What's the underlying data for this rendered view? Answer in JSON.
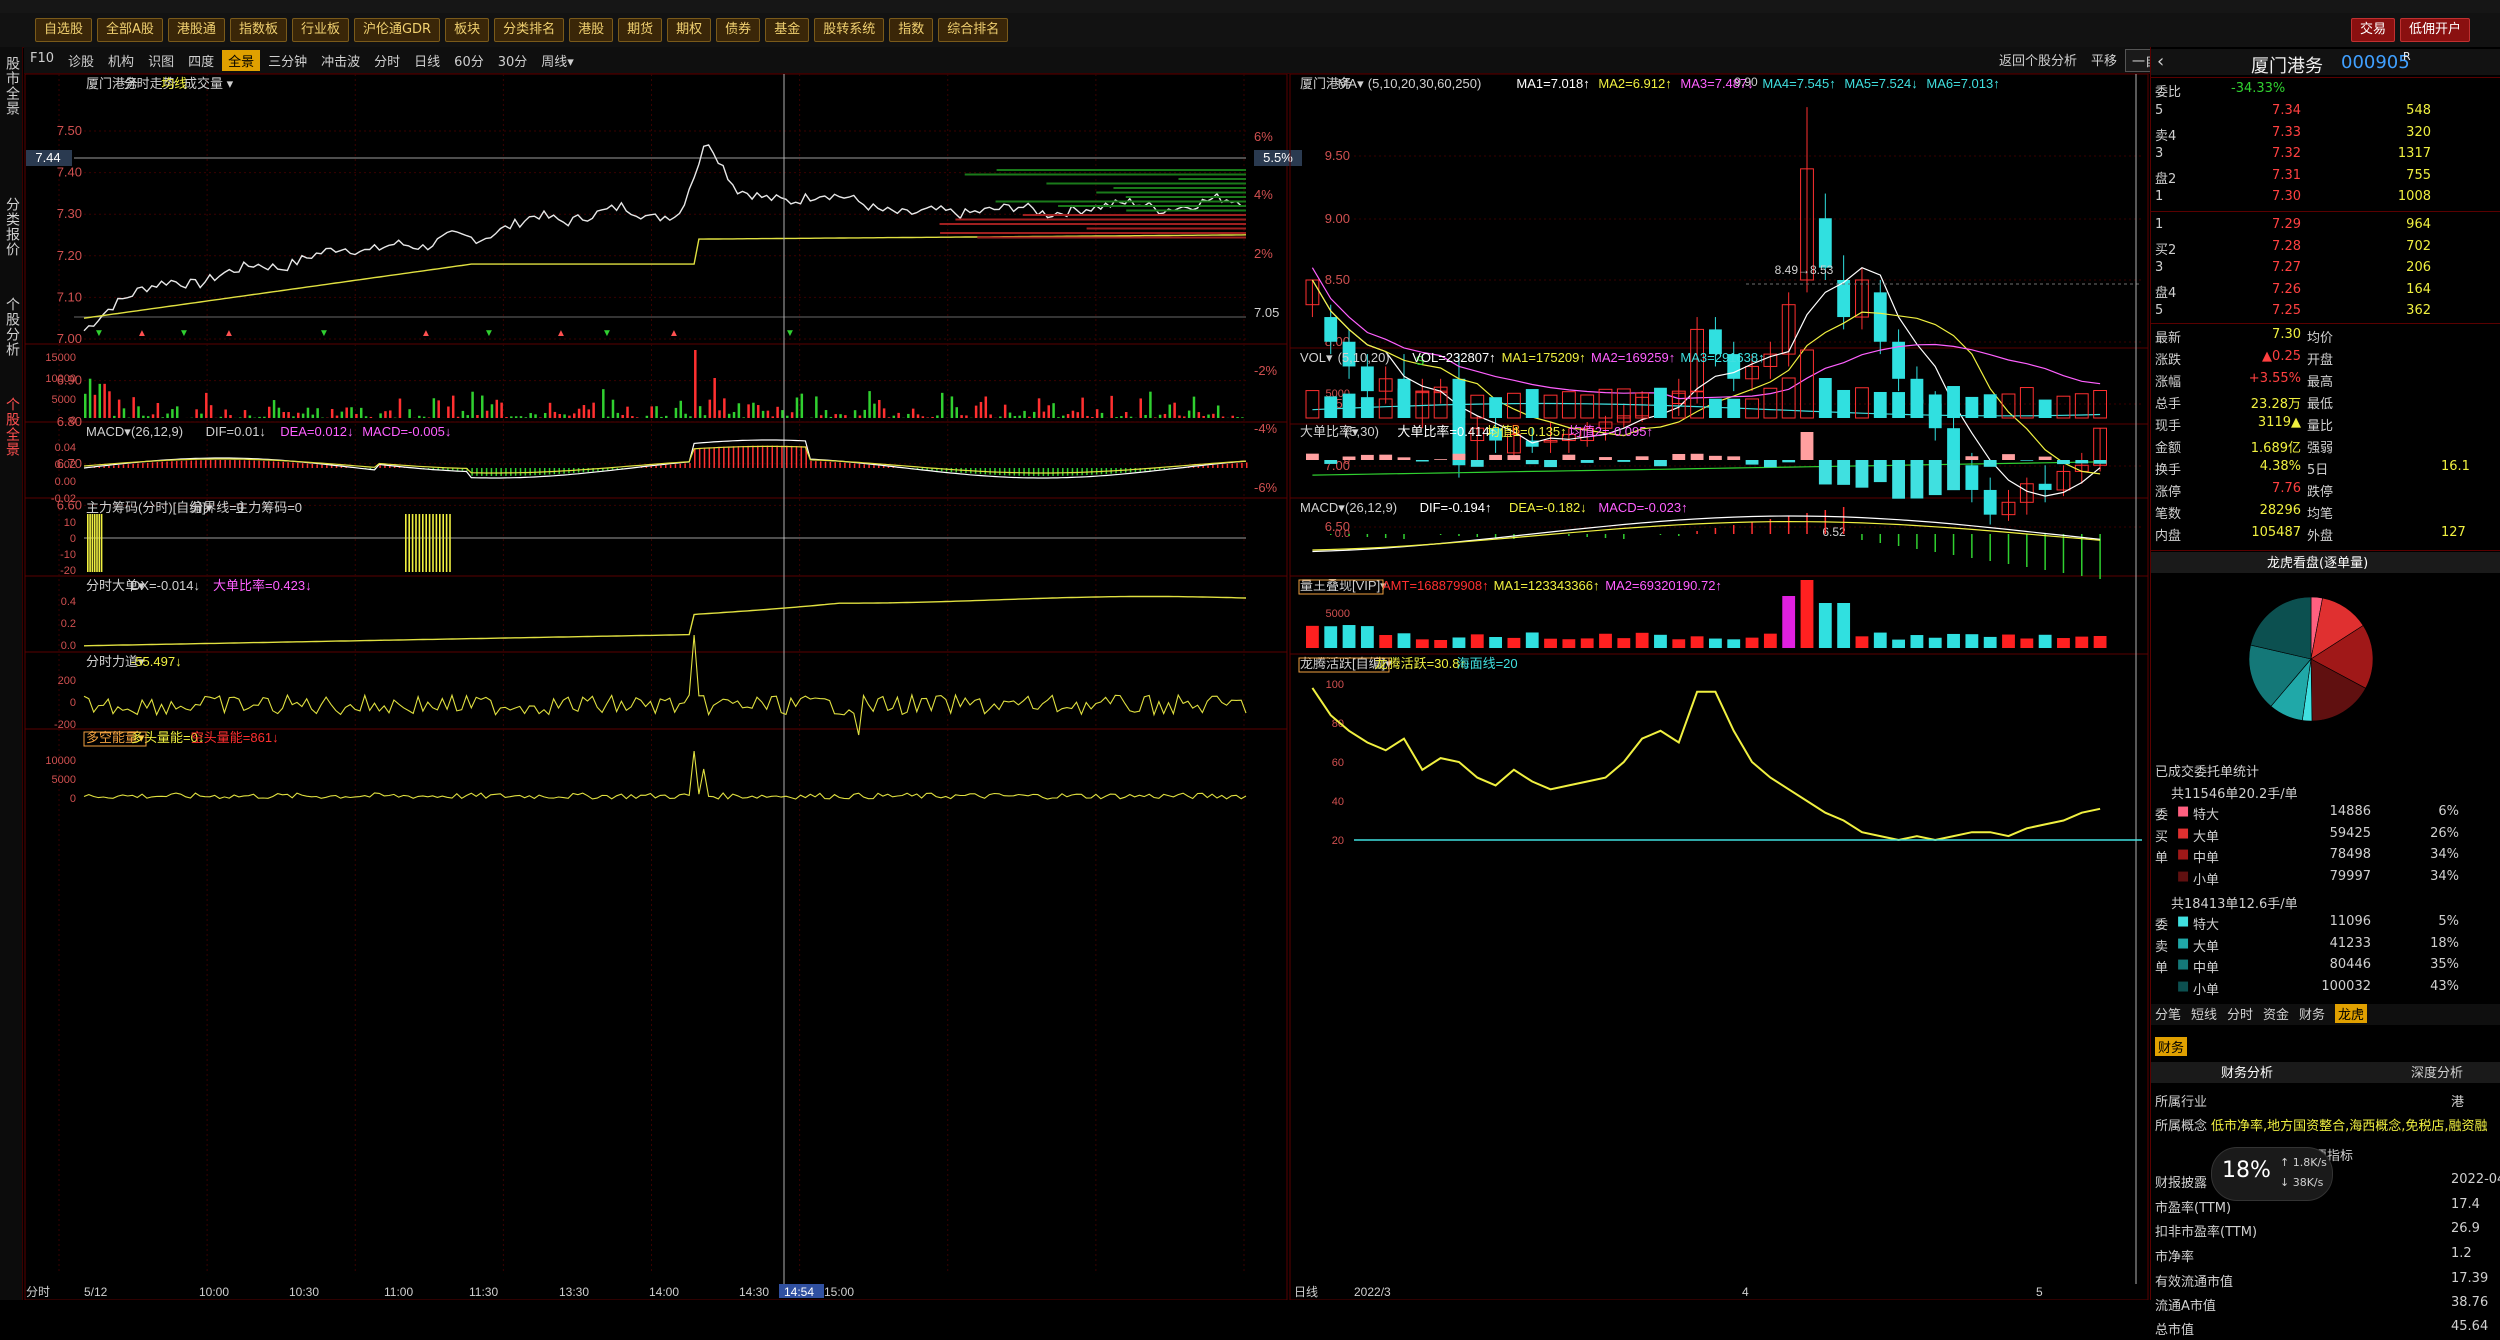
{
  "toolbar": {
    "buttons": [
      "自选股",
      "全部A股",
      "港股通",
      "指数板",
      "行业板",
      "沪伦通GDR",
      "板块",
      "分类排名",
      "港股",
      "期货",
      "期权",
      "债券",
      "基金",
      "股转系统",
      "指数",
      "综合排名"
    ],
    "right_buttons": [
      "交易",
      "低佣开户"
    ]
  },
  "left_tabs": [
    "股市全景",
    "分类报价",
    "个股分析",
    "个股全景"
  ],
  "subbar": {
    "left": [
      "F10",
      "诊股",
      "机构",
      "识图",
      "四度",
      "全景",
      "三分钟",
      "冲击波",
      "分时",
      "日线",
      "60分",
      "30分",
      "周线▾"
    ],
    "right": [
      "返回个股分析",
      "平移",
      "一自选"
    ]
  },
  "intraday": {
    "title": [
      "厦门港务",
      "分时走势",
      "均线",
      "成交量 ▾"
    ],
    "price_ticks": [
      "7.50",
      "7.40",
      "7.30",
      "7.20",
      "7.10",
      "7.00",
      "6.90",
      "6.80",
      "6.70",
      "6.60"
    ],
    "pct_ticks": [
      "6%",
      "4%",
      "2%",
      "7.05",
      "-2%",
      "-4%",
      "-6%"
    ],
    "current_price": "7.44",
    "current_pct": "5.5%",
    "vol_ticks": [
      "15000",
      "10000",
      "5000",
      "0"
    ],
    "macd_title": [
      "MACD▾",
      "(26,12,9)",
      "DIF=0.01↓",
      "DEA=0.012↓",
      "MACD=-0.005↓"
    ],
    "macd_ticks": [
      "0.04",
      "0.02",
      "0.00",
      "-0.02"
    ],
    "main_title": [
      "主力筹码(分时)[自编]▾",
      "分界线=0",
      "主力筹码=0"
    ],
    "main_ticks": [
      "10",
      "0",
      "-10",
      "-20"
    ],
    "big_title": [
      "分时大单▾",
      "DX=-0.014↓",
      "大单比率=0.423↓"
    ],
    "big_ticks": [
      "0.4",
      "0.2",
      "0.0"
    ],
    "force_title": [
      "分时力道▾",
      "-55.497↓"
    ],
    "force_ticks": [
      "200",
      "0",
      "-200"
    ],
    "energy_title": [
      "多空能量▾",
      "多头量能=0↓",
      "空头量能=861↓"
    ],
    "energy_ticks": [
      "10000",
      "5000",
      "0"
    ],
    "x_labels": [
      "分时",
      "5/12",
      "10:00",
      "10:30",
      "11:00",
      "11:30",
      "13:30",
      "14:00",
      "14:30",
      "14:54",
      "15:00"
    ]
  },
  "kline": {
    "title": [
      "厦门港务",
      "MA▾",
      "(5,10,20,30,60,250)",
      "MA1=7.018↑",
      "MA2=6.912↑",
      "MA3=7.487↓",
      "MA4=7.545↑",
      "MA5=7.524↓",
      "MA6=7.013↑"
    ],
    "price_ticks": [
      "9.50",
      "9.00",
      "8.50",
      "8.00",
      "7.50",
      "7.00",
      "6.50"
    ],
    "annot_high": "9.90",
    "annot_mid": "8.49→8.53",
    "annot_low": "6.52",
    "vol_title": [
      "VOL▾",
      "(5,10,20)",
      "VOL=232807↑",
      "MA1=175209↑",
      "MA2=169259↑",
      "MA3=291638↑"
    ],
    "vol_ticks": [
      "5000",
      "0"
    ],
    "ratio_title": [
      "大单比率▾",
      "(5,30)",
      "大单比率=0.414↑",
      "均值1=0.135↑",
      "均值2=-0.095↑"
    ],
    "ratio_ticks": [
      "0"
    ],
    "macd_title": [
      "MACD▾",
      "(26,12,9)",
      "DIF=-0.194↑",
      "DEA=-0.182↓",
      "MACD=-0.023↑"
    ],
    "macd_ticks": [
      "0.0"
    ],
    "amount_title": [
      "量王叠现[VIP]▾",
      "AMT=168879908↑",
      "MA1=123343366↑",
      "MA2=69320190.72↑"
    ],
    "amount_ticks": [
      "5000",
      "0"
    ],
    "dragon_title": [
      "龙腾活跃[自编]▾",
      "龙腾活跃=30.8↑",
      "海面线=20"
    ],
    "dragon_ticks": [
      "100",
      "80",
      "60",
      "40",
      "20"
    ],
    "x_labels": [
      "日线",
      "2022/3",
      "4",
      "5"
    ]
  },
  "quote": {
    "name": "厦门港务",
    "code": "000905",
    "webi_label": "委比",
    "webi_value": "-34.33%",
    "sells": [
      {
        "label": "5",
        "price": "7.34",
        "vol": "548"
      },
      {
        "label": "卖4",
        "price": "7.33",
        "vol": "320"
      },
      {
        "label": "3",
        "price": "7.32",
        "vol": "1317"
      },
      {
        "label": "盘2",
        "price": "7.31",
        "vol": "755"
      },
      {
        "label": "1",
        "price": "7.30",
        "vol": "1008"
      }
    ],
    "buys": [
      {
        "label": "1",
        "price": "7.29",
        "vol": "964"
      },
      {
        "label": "买2",
        "price": "7.28",
        "vol": "702"
      },
      {
        "label": "3",
        "price": "7.27",
        "vol": "206"
      },
      {
        "label": "盘4",
        "price": "7.26",
        "vol": "164"
      },
      {
        "label": "5",
        "price": "7.25",
        "vol": "362"
      }
    ],
    "stats": [
      {
        "l": "最新",
        "v": "7.30",
        "l2": "均价",
        "v2": ""
      },
      {
        "l": "涨跌",
        "v": "▲0.25",
        "l2": "开盘",
        "v2": ""
      },
      {
        "l": "涨幅",
        "v": "+3.55%",
        "l2": "最高",
        "v2": ""
      },
      {
        "l": "总手",
        "v": "23.28万",
        "l2": "最低",
        "v2": ""
      },
      {
        "l": "现手",
        "v": "3119▲",
        "l2": "量比",
        "v2": ""
      },
      {
        "l": "金额",
        "v": "1.689亿",
        "l2": "强弱",
        "v2": ""
      },
      {
        "l": "换手",
        "v": "4.38%",
        "l2": "5日",
        "v2": "16.1"
      },
      {
        "l": "涨停",
        "v": "7.76",
        "l2": "跌停",
        "v2": ""
      },
      {
        "l": "笔数",
        "v": "28296",
        "l2": "均笔",
        "v2": ""
      },
      {
        "l": "内盘",
        "v": "105487",
        "l2": "外盘",
        "v2": "127"
      }
    ],
    "dragon_header": "龙虎看盘(逐单量)",
    "done_title": "已成交委托单统计",
    "group1_head": "共11546单20.2手/单",
    "group1": [
      {
        "side": "委",
        "name": "特大",
        "vol": "14886",
        "pct": "6%",
        "color": "#ff6080"
      },
      {
        "side": "买",
        "name": "大单",
        "vol": "59425",
        "pct": "26%",
        "color": "#e03030"
      },
      {
        "side": "单",
        "name": "中单",
        "vol": "78498",
        "pct": "34%",
        "color": "#a01818"
      },
      {
        "side": "",
        "name": "小单",
        "vol": "79997",
        "pct": "34%",
        "color": "#601010"
      }
    ],
    "group2_head": "共18413单12.6手/单",
    "group2": [
      {
        "side": "委",
        "name": "特大",
        "vol": "11096",
        "pct": "5%",
        "color": "#40e0e0"
      },
      {
        "side": "卖",
        "name": "大单",
        "vol": "41233",
        "pct": "18%",
        "color": "#20a8a8"
      },
      {
        "side": "单",
        "name": "中单",
        "vol": "80446",
        "pct": "35%",
        "color": "#147878"
      },
      {
        "side": "",
        "name": "小单",
        "vol": "100032",
        "pct": "43%",
        "color": "#0c5050"
      }
    ],
    "bottom_tabs": [
      "分笔",
      "短线",
      "分时",
      "资金",
      "财务",
      "龙虎"
    ],
    "fin_tab": "财务",
    "fin_sub": [
      "财务分析",
      "深度分析"
    ],
    "fin_rows": [
      {
        "l": "所属行业",
        "v": "港"
      },
      {
        "l": "所属概念",
        "v": "低市净率,地方国资整合,海西概念,免税店,融资融"
      },
      {
        "l": "主要指标",
        "v": ""
      },
      {
        "l": "财报披露",
        "v": "2022-04-30"
      },
      {
        "l": "市盈率(TTM)",
        "v": "17.4"
      },
      {
        "l": "扣非市盈率(TTM)",
        "v": "26.9"
      },
      {
        "l": "市净率",
        "v": "1.2"
      },
      {
        "l": "有效流通市值",
        "v": "17.39"
      },
      {
        "l": "流通A市值",
        "v": "38.76"
      },
      {
        "l": "总市值",
        "v": "45.64"
      }
    ],
    "net_pct": "18",
    "net_up": "1.8K/s",
    "net_down": "38K/s"
  },
  "pie": [
    0.06,
    0.26,
    0.34,
    0.34,
    0.05,
    0.18,
    0.35,
    0.43
  ],
  "colors": {
    "up": "#ff3030",
    "down": "#30e0e0",
    "grid": "#5a0000",
    "yellow": "#f0f040"
  }
}
